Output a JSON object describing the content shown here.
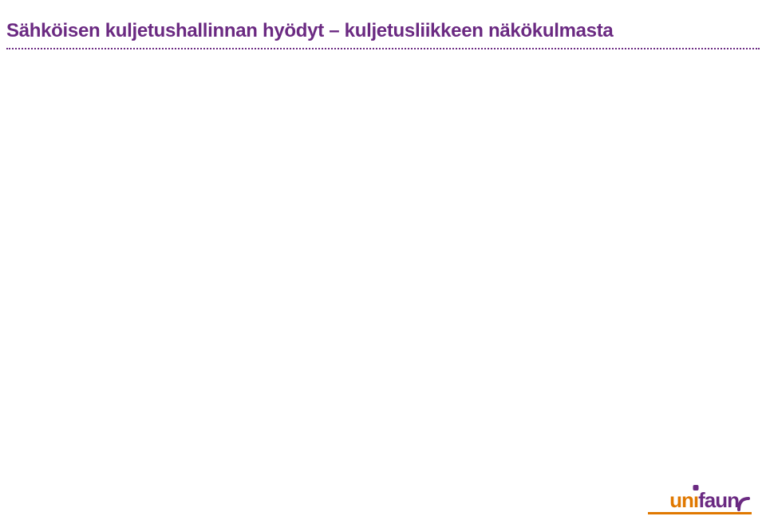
{
  "slide": {
    "title": "Sähköisen kuljetushallinnan hyödyt – kuljetusliikkeen näkökulmasta"
  },
  "brand": {
    "part1": "un",
    "part2": "faun",
    "accent_color": "#e07800",
    "primary_color": "#6b2a82"
  }
}
